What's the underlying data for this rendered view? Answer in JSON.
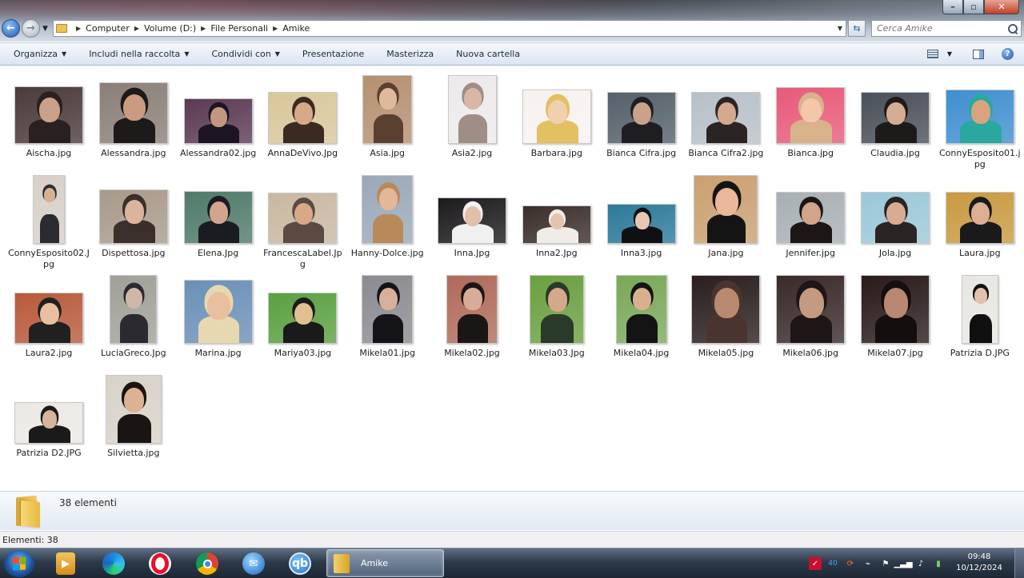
{
  "window": {
    "breadcrumb": [
      "Computer",
      "Volume (D:)",
      "File Personali",
      "Amike"
    ],
    "search_placeholder": "Cerca Amike"
  },
  "toolbar": {
    "items": [
      {
        "label": "Organizza",
        "dropdown": true
      },
      {
        "label": "Includi nella raccolta",
        "dropdown": true
      },
      {
        "label": "Condividi con",
        "dropdown": true
      },
      {
        "label": "Presentazione",
        "dropdown": false
      },
      {
        "label": "Masterizza",
        "dropdown": false
      },
      {
        "label": "Nuova cartella",
        "dropdown": false
      }
    ]
  },
  "files": [
    "Aischa.jpg",
    "Alessandra.jpg",
    "Alessandra02.jpg",
    "AnnaDeVivo.Jpg",
    "Asia.jpg",
    "Asia2.jpg",
    "Barbara.jpg",
    "Bianca Cifra.jpg",
    "Bianca Cifra2.jpg",
    "Bianca.jpg",
    "Claudia.jpg",
    "ConnyEsposito01.jpg",
    "ConnyEsposito02.Jpg",
    "Dispettosa.jpg",
    "Elena.Jpg",
    "FrancescaLabel.Jpg",
    "Hanny-Dolce.jpg",
    "Inna.Jpg",
    "Inna2.Jpg",
    "Inna3.jpg",
    "Jana.jpg",
    "Jennifer.jpg",
    "Jola.jpg",
    "Laura.jpg",
    "Laura2.jpg",
    "LuciaGreco.Jpg",
    "Marina.jpg",
    "Mariya03.jpg",
    "Mikela01.jpg",
    "Mikela02.jpg",
    "Mikela03.Jpg",
    "Mikela04.jpg",
    "Mikela05.jpg",
    "Mikela06.jpg",
    "Mikela07.jpg",
    "Patrizia D.JPG",
    "Patrizia D2.JPG",
    "Silvietta.jpg"
  ],
  "details": {
    "count": "38 elementi"
  },
  "status": {
    "text": "Elementi: 38"
  },
  "taskbar": {
    "apps": [
      "media-player-icon",
      "edge-icon",
      "opera-icon",
      "chrome-icon",
      "thunderbird-icon",
      "qbittorrent-icon"
    ],
    "qb_label": "qb",
    "window_label": "Amike",
    "tray_label": "40",
    "time": "09:48",
    "date": "10/12/2024"
  }
}
